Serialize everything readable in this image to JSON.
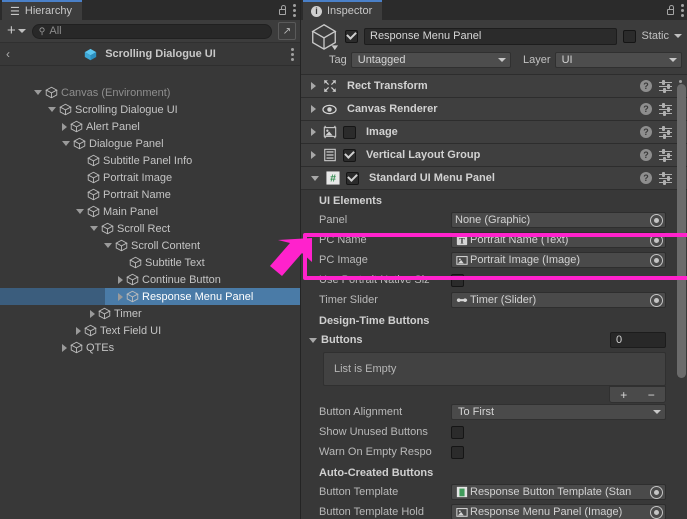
{
  "hierarchy": {
    "tab_label": "Hierarchy",
    "tab_icon": "list-icon",
    "toolbar": {
      "add_label": "+",
      "search_placeholder": "All",
      "search_value": ""
    },
    "breadcrumb": {
      "back": "‹",
      "title": "Scrolling Dialogue UI"
    },
    "tree": [
      {
        "label": "Canvas (Environment)",
        "depth": 1,
        "toggle": "down",
        "dim": true,
        "selected": false
      },
      {
        "label": "Scrolling Dialogue UI",
        "depth": 2,
        "toggle": "down",
        "dim": false,
        "selected": false
      },
      {
        "label": "Alert Panel",
        "depth": 3,
        "toggle": "right",
        "dim": false,
        "selected": false
      },
      {
        "label": "Dialogue Panel",
        "depth": 3,
        "toggle": "down",
        "dim": false,
        "selected": false
      },
      {
        "label": "Subtitle Panel Info",
        "depth": 4,
        "toggle": "none",
        "dim": false,
        "selected": false
      },
      {
        "label": "Portrait Image",
        "depth": 4,
        "toggle": "none",
        "dim": false,
        "selected": false
      },
      {
        "label": "Portrait Name",
        "depth": 4,
        "toggle": "none",
        "dim": false,
        "selected": false
      },
      {
        "label": "Main Panel",
        "depth": 4,
        "toggle": "down",
        "dim": false,
        "selected": false
      },
      {
        "label": "Scroll Rect",
        "depth": 5,
        "toggle": "down",
        "dim": false,
        "selected": false
      },
      {
        "label": "Scroll Content",
        "depth": 6,
        "toggle": "down",
        "dim": false,
        "selected": false
      },
      {
        "label": "Subtitle Text",
        "depth": 7,
        "toggle": "none",
        "dim": false,
        "selected": false
      },
      {
        "label": "Continue Button",
        "depth": 7,
        "toggle": "right",
        "dim": false,
        "selected": false
      },
      {
        "label": "Response Menu Panel",
        "depth": 7,
        "toggle": "right",
        "dim": false,
        "selected": true
      },
      {
        "label": "Timer",
        "depth": 5,
        "toggle": "right",
        "dim": false,
        "selected": false
      },
      {
        "label": "Text Field UI",
        "depth": 4,
        "toggle": "right",
        "dim": false,
        "selected": false
      },
      {
        "label": "QTEs",
        "depth": 3,
        "toggle": "right",
        "dim": false,
        "selected": false
      }
    ]
  },
  "inspector": {
    "tab_label": "Inspector",
    "tab_icon": "info-icon",
    "header": {
      "enabled": true,
      "object_name": "Response Menu Panel",
      "static_label": "Static",
      "static_checked": false,
      "tag_label": "Tag",
      "tag_value": "Untagged",
      "layer_label": "Layer",
      "layer_value": "UI"
    },
    "components": [
      {
        "name": "Rect Transform",
        "icon": "rect-transform-icon",
        "expanded": false,
        "has_toggle": false,
        "enabled": false
      },
      {
        "name": "Canvas Renderer",
        "icon": "eye-icon",
        "expanded": false,
        "has_toggle": false,
        "enabled": false
      },
      {
        "name": "Image",
        "icon": "image-icon",
        "expanded": false,
        "has_toggle": true,
        "enabled": false
      },
      {
        "name": "Vertical Layout Group",
        "icon": "layout-group-icon",
        "expanded": false,
        "has_toggle": true,
        "enabled": true
      },
      {
        "name": "Standard UI Menu Panel",
        "icon": "script-icon",
        "expanded": true,
        "has_toggle": true,
        "enabled": true
      }
    ],
    "sections": {
      "ui_elements": "UI Elements",
      "design_time_buttons": "Design-Time Buttons",
      "auto_created_buttons": "Auto-Created Buttons"
    },
    "fields": {
      "panel": {
        "label": "Panel",
        "value": "None (Graphic)",
        "icon": "none-icon"
      },
      "pc_name": {
        "label": "PC Name",
        "value": "Portrait Name (Text)",
        "icon": "text-icon"
      },
      "pc_image": {
        "label": "PC Image",
        "value": "Portrait Image (Image)",
        "icon": "image-icon"
      },
      "use_native": {
        "label": "Use Portrait Native Siz",
        "checked": false
      },
      "timer_slider": {
        "label": "Timer Slider",
        "value": "Timer (Slider)",
        "icon": "slider-icon"
      },
      "buttons_fold": {
        "label": "Buttons",
        "count": "0"
      },
      "buttons_list": {
        "empty_text": "List is Empty",
        "add": "+",
        "remove": "−"
      },
      "button_alignment": {
        "label": "Button Alignment",
        "value": "To First"
      },
      "show_unused": {
        "label": "Show Unused Buttons",
        "checked": false
      },
      "warn_empty": {
        "label": "Warn On Empty Respo",
        "checked": false
      },
      "button_template": {
        "label": "Button Template",
        "value": "Response Button Template (Stan",
        "icon": "prefab-icon"
      },
      "button_template_holder": {
        "label": "Button Template Hold",
        "value": "Response Menu Panel (Image)",
        "icon": "image-icon"
      }
    }
  },
  "annotation": {
    "highlight_color": "#ff22cc",
    "arrow_name": "callout-arrow",
    "box_name": "highlight-box-pc-fields"
  }
}
